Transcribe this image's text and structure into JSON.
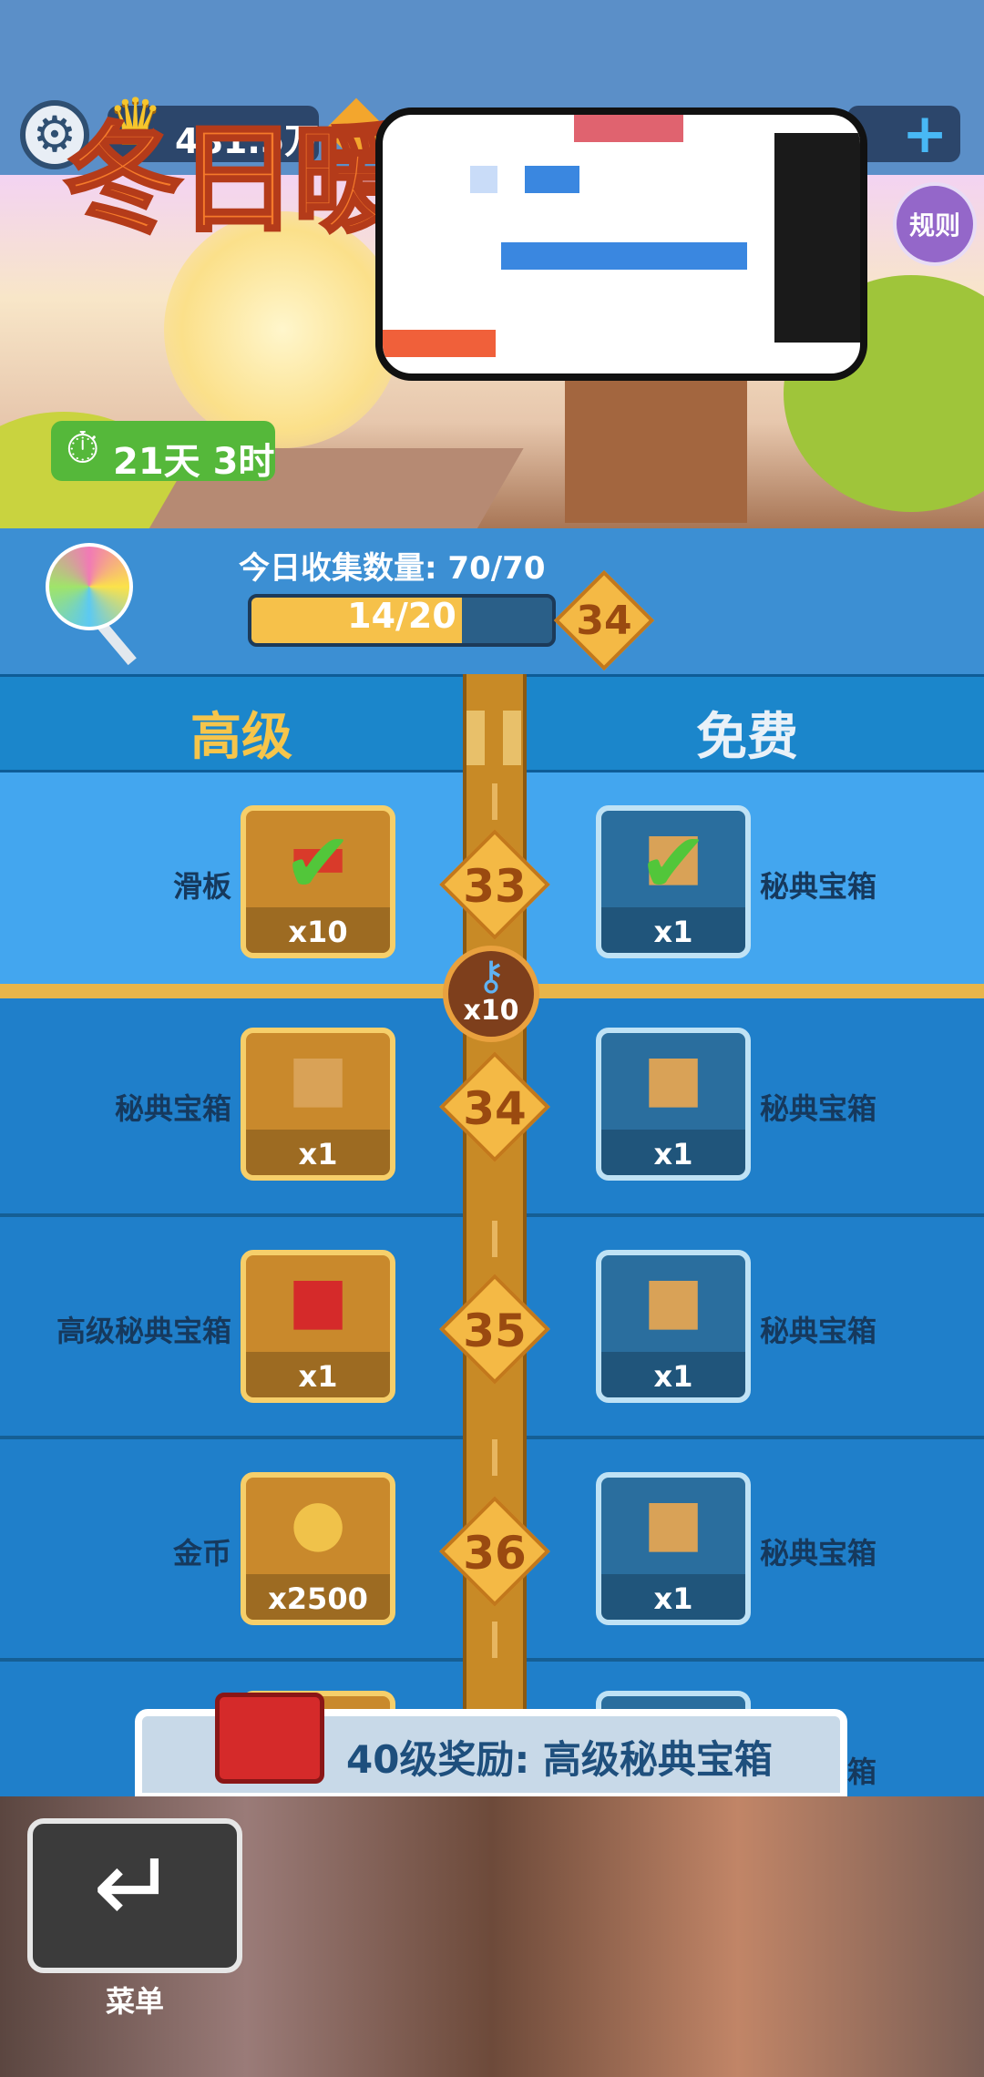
{
  "top_bar": {
    "settings_icon": "gear-icon",
    "crown_icon": "crown-icon",
    "currency_value": "481.5万",
    "gem_icon": "gem-icon",
    "add_icon": "plus-icon"
  },
  "banner": {
    "title": "冬日暖",
    "timer_icon": "stopwatch-icon",
    "timer_text": "21天 3时",
    "rules_label": "规则"
  },
  "collection": {
    "label": "今日收集数量: 70/70",
    "progress_text": "14/20",
    "progress": 0.7,
    "current_level": "34"
  },
  "columns": {
    "premium": "高级",
    "free": "免费"
  },
  "rows": [
    {
      "level": "33",
      "premium": {
        "name": "滑板",
        "count": "x10",
        "icon": "skateboard-icon",
        "claimed": true
      },
      "free": {
        "name": "秘典宝箱",
        "count": "x1",
        "icon": "box-icon",
        "claimed": true
      }
    },
    {
      "level": "34",
      "premium": {
        "name": "秘典宝箱",
        "count": "x1",
        "icon": "box-icon",
        "claimed": false
      },
      "free": {
        "name": "秘典宝箱",
        "count": "x1",
        "icon": "box-icon",
        "claimed": false
      }
    },
    {
      "level": "35",
      "premium": {
        "name": "高级秘典宝箱",
        "count": "x1",
        "icon": "red-box-icon",
        "claimed": false
      },
      "free": {
        "name": "秘典宝箱",
        "count": "x1",
        "icon": "box-icon",
        "claimed": false
      }
    },
    {
      "level": "36",
      "premium": {
        "name": "金币",
        "count": "x2500",
        "icon": "coin-bag-icon",
        "claimed": false
      },
      "free": {
        "name": "秘典宝箱",
        "count": "x1",
        "icon": "box-icon",
        "claimed": false
      }
    }
  ],
  "key_reward": {
    "count": "x10",
    "icon": "key-icon"
  },
  "partial_row_label": "箱",
  "bottom_reward": {
    "text": "40级奖励: 高级秘典宝箱"
  },
  "menu": {
    "label": "菜单"
  },
  "colors": {
    "premium_gold": "#f6c54b",
    "free_blue": "#1b86cb",
    "road": "#c88a26"
  }
}
